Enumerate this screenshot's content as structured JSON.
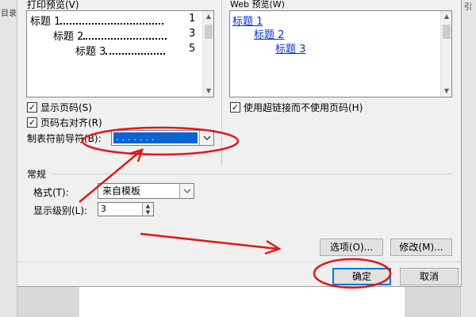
{
  "background": {
    "left_tab": "目录",
    "right_tab": "引"
  },
  "print_preview": {
    "label": "打印预览(V)",
    "entries": [
      {
        "title": "标题 1",
        "page": "1"
      },
      {
        "title": "标题 2",
        "page": "3"
      },
      {
        "title": "标题 3",
        "page": "5"
      }
    ]
  },
  "web_preview": {
    "label": "Web 预览(W)",
    "entries": [
      "标题 1",
      "标题 2",
      "标题 3"
    ]
  },
  "options": {
    "show_page_numbers": {
      "label": "显示页码(S)",
      "checked": true
    },
    "right_align": {
      "label": "页码右对齐(R)",
      "checked": true
    },
    "use_hyperlinks": {
      "label": "使用超链接而不使用页码(H)",
      "checked": true
    },
    "tab_leader": {
      "label": "制表符前导符(B):",
      "value": "......."
    }
  },
  "general": {
    "section_label": "常规",
    "format": {
      "label": "格式(T):",
      "value": "来自模板"
    },
    "levels": {
      "label": "显示级别(L):",
      "value": "3"
    }
  },
  "buttons": {
    "options": "选项(O)...",
    "modify": "修改(M)...",
    "ok": "确定",
    "cancel": "取消"
  },
  "colors": {
    "selection": "#0a64d2",
    "link": "#0033cc",
    "annotation": "#e01818"
  },
  "icons": {
    "check": "check-icon",
    "dropdown": "chevron-down-icon",
    "spin_up": "spin-up-icon",
    "spin_down": "spin-down-icon"
  }
}
